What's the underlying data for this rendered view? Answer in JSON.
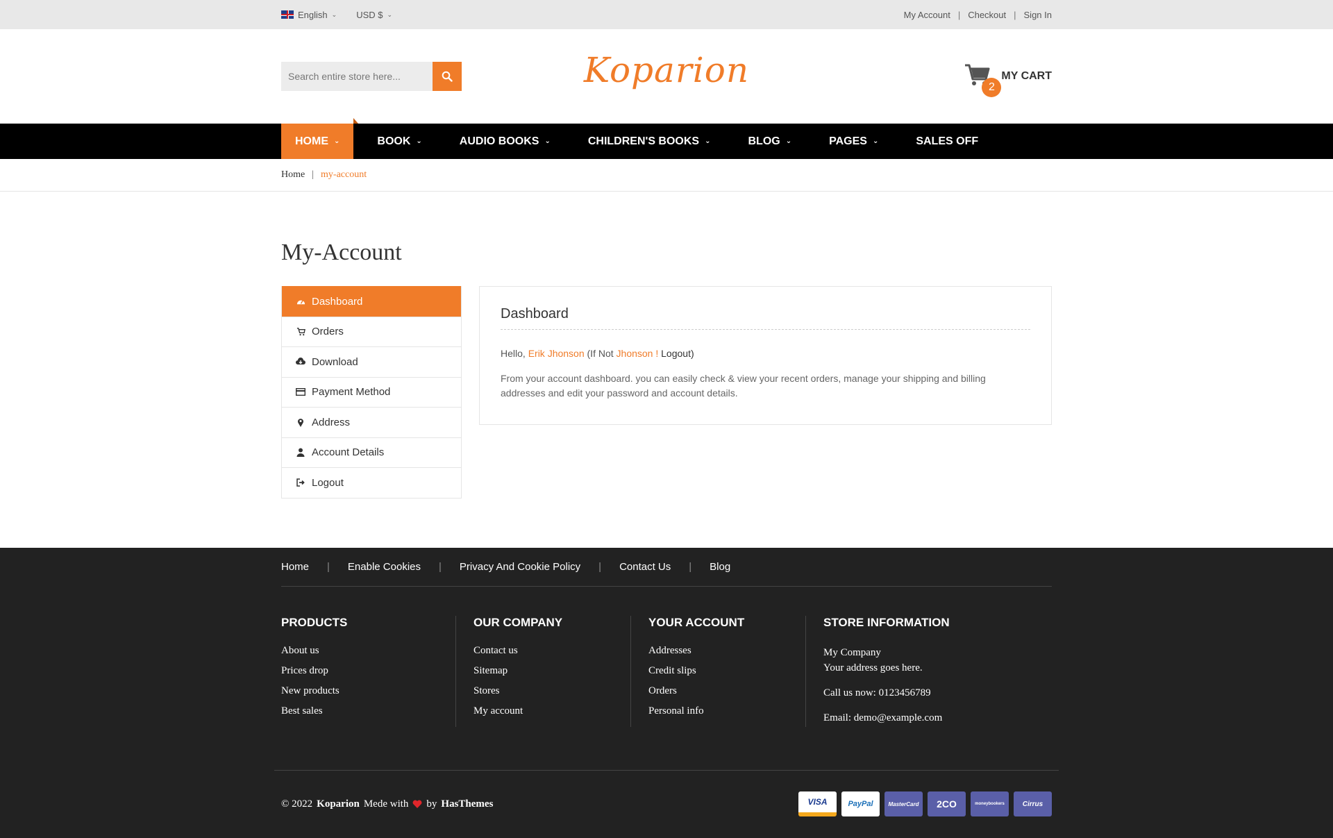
{
  "topbar": {
    "language": "English",
    "currency": "USD $",
    "links": [
      "My Account",
      "Checkout",
      "Sign In"
    ]
  },
  "header": {
    "search_placeholder": "Search entire store here...",
    "logo": "Koparion",
    "cart_count": "2",
    "cart_label": "MY CART"
  },
  "nav": {
    "items": [
      {
        "label": "HOME",
        "dropdown": true
      },
      {
        "label": "BOOK",
        "dropdown": true
      },
      {
        "label": "AUDIO BOOKS",
        "dropdown": true
      },
      {
        "label": "CHILDREN'S BOOKS",
        "dropdown": true
      },
      {
        "label": "BLOG",
        "dropdown": true
      },
      {
        "label": "PAGES",
        "dropdown": true
      },
      {
        "label": "SALES OFF",
        "dropdown": false
      }
    ]
  },
  "breadcrumb": {
    "home": "Home",
    "current": "my-account"
  },
  "page_title": "My-Account",
  "account_menu": [
    {
      "label": "Dashboard",
      "icon": "dashboard-icon"
    },
    {
      "label": "Orders",
      "icon": "cart-icon"
    },
    {
      "label": "Download",
      "icon": "cloud-download-icon"
    },
    {
      "label": "Payment Method",
      "icon": "credit-card-icon"
    },
    {
      "label": "Address",
      "icon": "map-marker-icon"
    },
    {
      "label": "Account Details",
      "icon": "user-icon"
    },
    {
      "label": "Logout",
      "icon": "logout-icon"
    }
  ],
  "dashboard": {
    "title": "Dashboard",
    "hello": "Hello,",
    "name": "Erik Jhonson",
    "if_not": "(If Not",
    "name_short": "Jhonson !",
    "logout": "Logout",
    "close_paren": ")",
    "description": "From your account dashboard. you can easily check & view your recent orders, manage your shipping and billing addresses and edit your password and account details."
  },
  "footer": {
    "links": [
      "Home",
      "Enable Cookies",
      "Privacy And Cookie Policy",
      "Contact Us",
      "Blog"
    ],
    "columns": [
      {
        "title": "PRODUCTS",
        "items": [
          "About us",
          "Prices drop",
          "New products",
          "Best sales"
        ]
      },
      {
        "title": "OUR COMPANY",
        "items": [
          "Contact us",
          "Sitemap",
          "Stores",
          "My account"
        ]
      },
      {
        "title": "YOUR ACCOUNT",
        "items": [
          "Addresses",
          "Credit slips",
          "Orders",
          "Personal info"
        ]
      }
    ],
    "store": {
      "title": "STORE INFORMATION",
      "company": "My Company",
      "address": "Your address goes here.",
      "phone": "Call us now: 0123456789",
      "email": "Email: demo@example.com"
    },
    "copyright": "© 2022",
    "brand": "Koparion",
    "made_with": "Mede with",
    "by": "by",
    "author": "HasThemes",
    "payments": [
      "VISA",
      "PayPal",
      "MasterCard",
      "2CO",
      "moneybookers",
      "Cirrus"
    ]
  },
  "colors": {
    "accent": "#f07c29",
    "nav_bg": "#000000",
    "footer_bg": "#222222"
  }
}
